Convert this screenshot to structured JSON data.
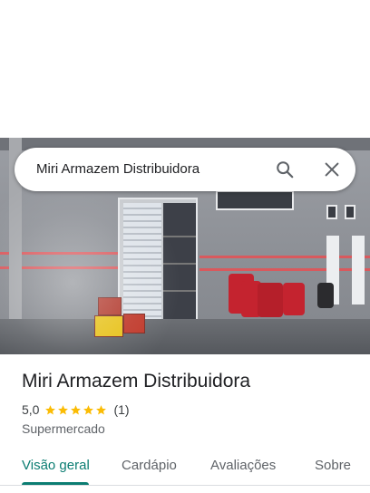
{
  "search": {
    "query": "Miri Armazem Distribuidora",
    "search_icon": "search-icon",
    "close_icon": "close-icon"
  },
  "place": {
    "name": "Miri Armazem Distribuidora",
    "rating": "5,0",
    "stars_filled": 5,
    "review_count": "(1)",
    "category": "Supermercado"
  },
  "tabs": [
    {
      "label": "Visão geral",
      "active": true
    },
    {
      "label": "Cardápio",
      "active": false
    },
    {
      "label": "Avaliações",
      "active": false
    },
    {
      "label": "Sobre",
      "active": false
    }
  ],
  "colors": {
    "accent": "#0b7d72",
    "star": "#fbbc04"
  }
}
